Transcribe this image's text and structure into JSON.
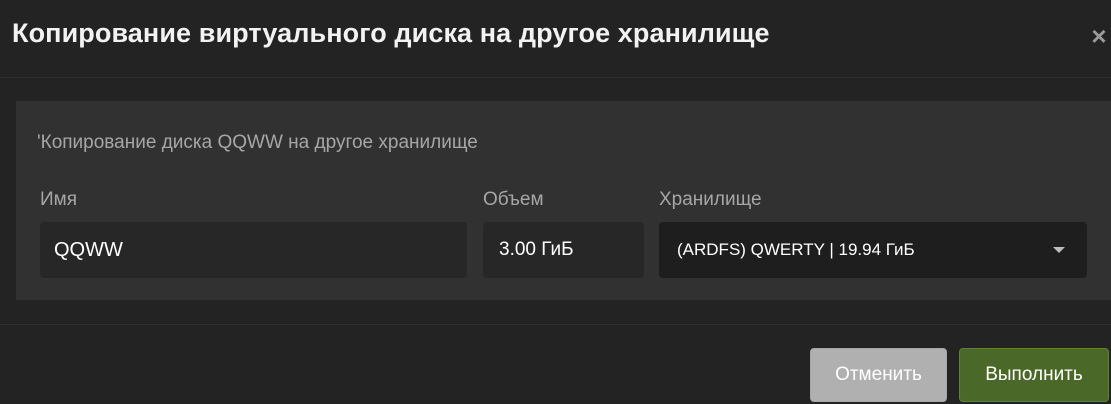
{
  "dialog": {
    "title": "Копирование виртуального диска на другое хранилище",
    "close_label": "×",
    "subtitle": "'Копирование диска QQWW на другое хранилище"
  },
  "form": {
    "name": {
      "label": "Имя",
      "value": "QQWW"
    },
    "size": {
      "label": "Объем",
      "value": "3.00 ГиБ"
    },
    "storage": {
      "label": "Хранилище",
      "selected": "(ARDFS) QWERTY | 19.94 ГиБ"
    }
  },
  "footer": {
    "cancel_label": "Отменить",
    "submit_label": "Выполнить"
  },
  "colors": {
    "background": "#232323",
    "panel": "#313131",
    "submit_button": "#4a6828",
    "cancel_button": "#b0b0b0"
  }
}
